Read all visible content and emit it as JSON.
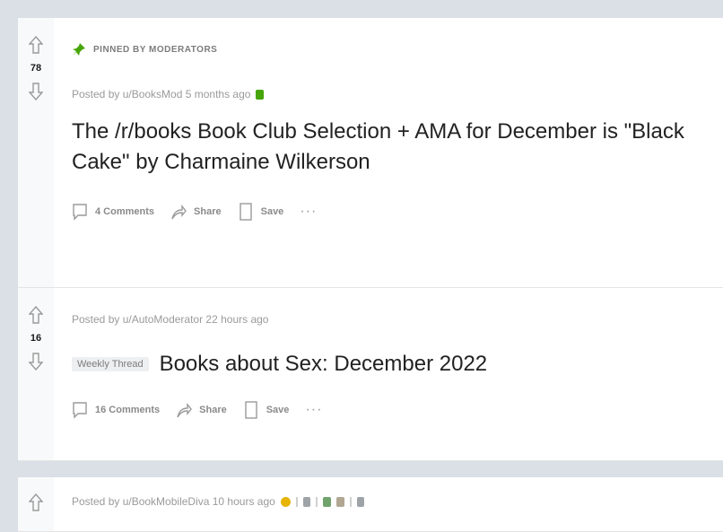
{
  "colors": {
    "background": "#dae0e6",
    "mod_green": "#46a508",
    "award_gold": "#e7b400"
  },
  "posts": [
    {
      "pinned_label": "PINNED BY MODERATORS",
      "score": "78",
      "meta": "Posted by u/BooksMod 5 months ago",
      "title": "The /r/books Book Club Selection + AMA for December is \"Black Cake\" by Charmaine Wilkerson",
      "comments": "4 Comments",
      "share": "Share",
      "save": "Save",
      "more": "···"
    },
    {
      "score": "16",
      "meta": "Posted by u/AutoModerator 22 hours ago",
      "flair": "Weekly Thread",
      "title": "Books about Sex: December 2022",
      "comments": "16 Comments",
      "share": "Share",
      "save": "Save",
      "more": "···"
    },
    {
      "meta": "Posted by u/BookMobileDiva 10 hours ago"
    }
  ],
  "icons": {
    "upvote": "upvote-arrow-icon",
    "downvote": "downvote-arrow-icon",
    "pin": "pin-icon",
    "comment": "comment-icon",
    "share": "share-icon",
    "save": "bookmark-icon"
  }
}
